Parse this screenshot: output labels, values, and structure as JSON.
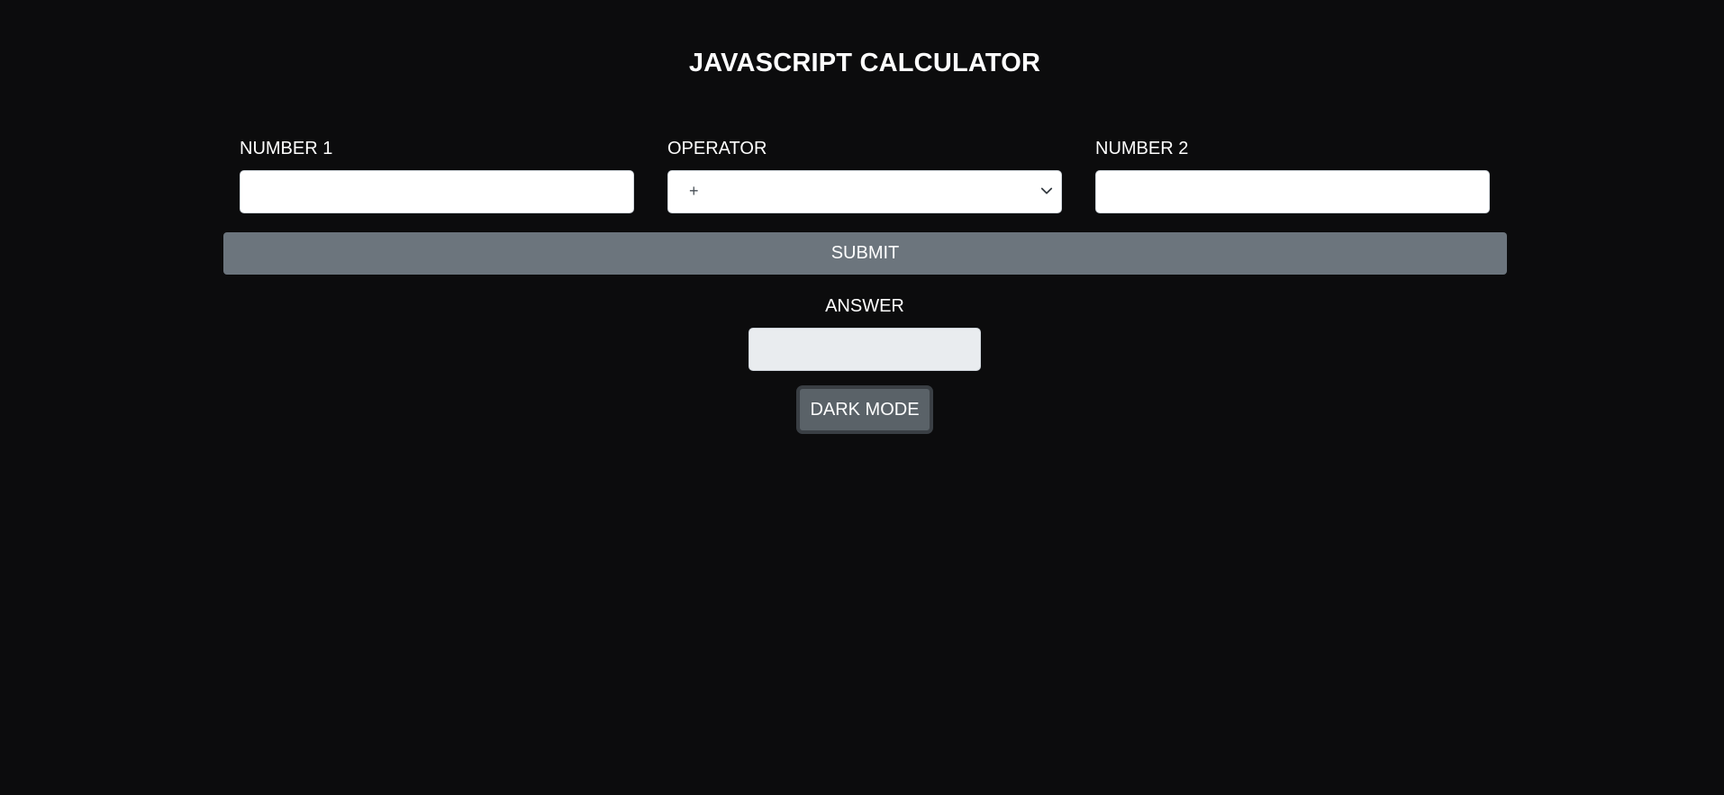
{
  "page": {
    "title": "JAVASCRIPT CALCULATOR"
  },
  "form": {
    "number1": {
      "label": "NUMBER 1",
      "value": "",
      "placeholder": ""
    },
    "operator": {
      "label": "OPERATOR",
      "selected": "+",
      "icon": "chevron-down-icon"
    },
    "number2": {
      "label": "NUMBER 2",
      "value": "",
      "placeholder": ""
    },
    "submit_label": "SUBMIT"
  },
  "answer": {
    "label": "ANSWER",
    "value": ""
  },
  "dark_mode_label": "DARK MODE",
  "colors": {
    "background": "#0c0c0d",
    "submit_button": "#6c757d",
    "dark_mode_button": "#5a6268",
    "answer_field": "#e9ecef"
  }
}
